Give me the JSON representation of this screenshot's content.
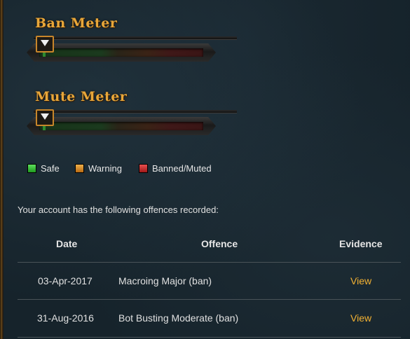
{
  "meters": [
    {
      "title": "Ban Meter",
      "level": 0
    },
    {
      "title": "Mute Meter",
      "level": 0
    }
  ],
  "legend": [
    {
      "label": "Safe",
      "color": "#2eb82e"
    },
    {
      "label": "Warning",
      "color": "#e09a2a"
    },
    {
      "label": "Banned/Muted",
      "color": "#c82020"
    }
  ],
  "intro_text": "Your account has the following offences recorded:",
  "table": {
    "headers": [
      "Date",
      "Offence",
      "Evidence"
    ],
    "rows": [
      {
        "date": "03-Apr-2017",
        "offence": "Macroing Major (ban)",
        "evidence": "View"
      },
      {
        "date": "31-Aug-2016",
        "offence": "Bot Busting Moderate (ban)",
        "evidence": "View"
      }
    ]
  },
  "colors": {
    "accent": "#e8a73a",
    "link": "#f3b233",
    "background": "#16232b"
  }
}
